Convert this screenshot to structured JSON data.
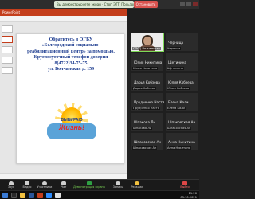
{
  "share_bar": {
    "message": "Вы демонстрируете экран · Стоп ЭТТ· Пользователь - 1",
    "stop_label": "Остановить"
  },
  "ppt": {
    "title": "PowerPoint"
  },
  "slide": {
    "line1": "Обратитесь в ОГБУ",
    "line2": "«Белгородский социально-",
    "line3": "реабилитационный центр» за помощью.",
    "line4": "Круглосуточный телефон доверия",
    "line5": "8(4722)34-75-75",
    "line6": "ул. Волчанская д. 159",
    "banner_top": "ВЫБИРАЮ",
    "banner_main": "Жизнь!"
  },
  "participants": [
    {
      "name": "Юлия Никитина",
      "label": "Юлия Никитина"
    },
    {
      "name": "Щетинина",
      "label": "Щетинина"
    },
    {
      "name": "Дарья Кобзева",
      "label": "Дарья Кобзева"
    },
    {
      "name": "Юлия Кобзева",
      "label": "Юлия Кобзева"
    },
    {
      "name": "Прудченко Настя",
      "label": "Прудченко Настя"
    },
    {
      "name": "Елена Кали",
      "label": "Елена Кали"
    },
    {
      "name": "Шпакова Ли",
      "label": "Шпакова Ли"
    },
    {
      "name": "Шпаковская Ан...",
      "label": "Шпаковская Ан"
    },
    {
      "name": "Шпаковская Ан",
      "label": "Шпаковская Ан"
    }
  ],
  "video": {
    "label": "СПО | Волчанская"
  },
  "top_right_tiles": [
    {
      "name": "Черница",
      "label": "Черница"
    },
    {
      "name": "Анна Никитина",
      "label": "Анна Никитина"
    }
  ],
  "toolbar": {
    "items": [
      {
        "label": "Звук"
      },
      {
        "label": "Видео"
      },
      {
        "label": "Участники"
      },
      {
        "label": "Чат"
      },
      {
        "label": "Демонстрация экрана"
      },
      {
        "label": "Запись"
      },
      {
        "label": "Реакции"
      },
      {
        "label": "Выйти"
      }
    ]
  },
  "clock": {
    "time": "11:20",
    "date": "05.10.2021"
  }
}
